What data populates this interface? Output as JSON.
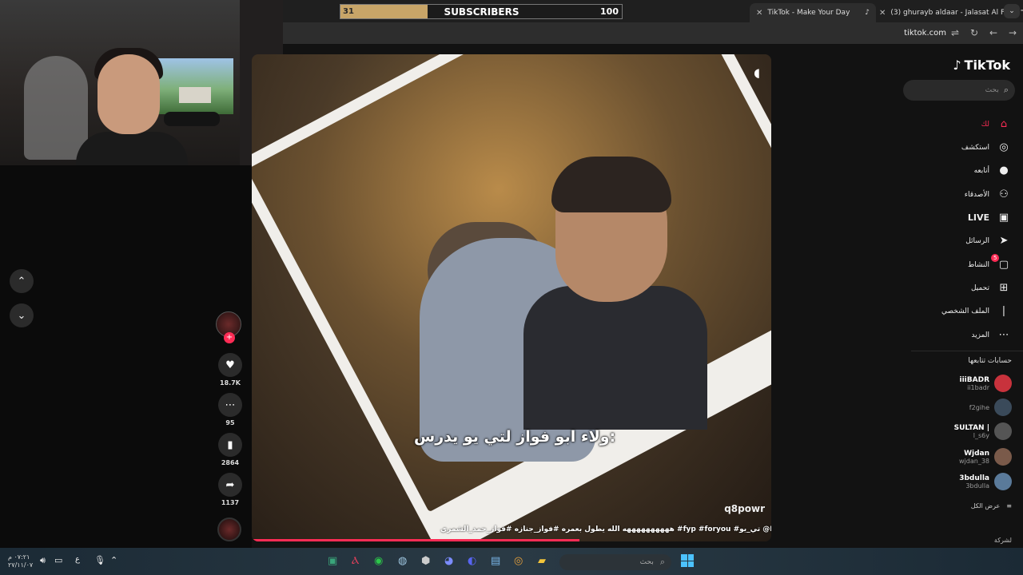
{
  "overlay": {
    "subscribers": {
      "label": "SUBSCRIBERS",
      "current": "31",
      "goal": "100",
      "progress": 0.31
    }
  },
  "browser": {
    "tabs": [
      {
        "title": "TikTok - Make Your Day",
        "active": true
      },
      {
        "title": "(3) ghurayb aldaar - Jalasat Al F",
        "active": false
      }
    ],
    "new_tab": "+",
    "tab_menu": "⌄",
    "url": "tiktok.com"
  },
  "sidebar": {
    "logo": "TikTok",
    "search_placeholder": "بحث",
    "nav": [
      {
        "label": "لك",
        "icon": "home-icon",
        "glyph": "⌂"
      },
      {
        "label": "استكشف",
        "icon": "compass-icon",
        "glyph": "◎"
      },
      {
        "label": "أتابعه",
        "icon": "following-avatar-icon",
        "glyph": "●"
      },
      {
        "label": "الأصدقاء",
        "icon": "friends-icon",
        "glyph": "⚇"
      },
      {
        "label": "LIVE",
        "icon": "live-icon",
        "glyph": "▣"
      },
      {
        "label": "الرسائل",
        "icon": "messages-icon",
        "glyph": "➤"
      },
      {
        "label": "النشاط",
        "icon": "activity-icon",
        "glyph": "▢",
        "badge": "5"
      },
      {
        "label": "تحميل",
        "icon": "upload-icon",
        "glyph": "⊞"
      },
      {
        "label": "الملف الشخصي",
        "icon": "profile-icon",
        "glyph": "❘"
      },
      {
        "label": "المزيد",
        "icon": "more-icon",
        "glyph": "⋯"
      }
    ],
    "following_title": "حسابات تتابعها",
    "accounts": [
      {
        "name": "iiiBADR",
        "handle": "ii1badr",
        "color": "#c8323c"
      },
      {
        "name": "",
        "handle": "f2gihe",
        "color": "#3a4a5a"
      },
      {
        "name": "SULTAN |",
        "handle": "l_s6y",
        "color": "#555555"
      },
      {
        "name": "Wjdan",
        "handle": "wjdan_38",
        "color": "#7a5a4a"
      },
      {
        "name": "3bdulla",
        "handle": "3bdulla",
        "color": "#5a7a9a"
      }
    ],
    "see_all": "عرض الكل",
    "company": "لشركة"
  },
  "video": {
    "caption_overlay": "ولاء ابو فواز لتي يو يدرس:",
    "watermark": "q8powr",
    "description": "ههههههههههه الله يطول بعمره #فواز_جنازه #فواز_حمد_الشمري #fyp #foryou #تي_يو @FwazFH",
    "progress": 0.63
  },
  "actions": {
    "likes": "18.7K",
    "comments": "95",
    "bookmarks": "2864",
    "shares": "1137"
  },
  "taskbar": {
    "clock_time": "٠٧:٢١ م",
    "clock_date": "٢٧/١١/٠٧",
    "search_placeholder": "بحث",
    "lang": "ع"
  }
}
